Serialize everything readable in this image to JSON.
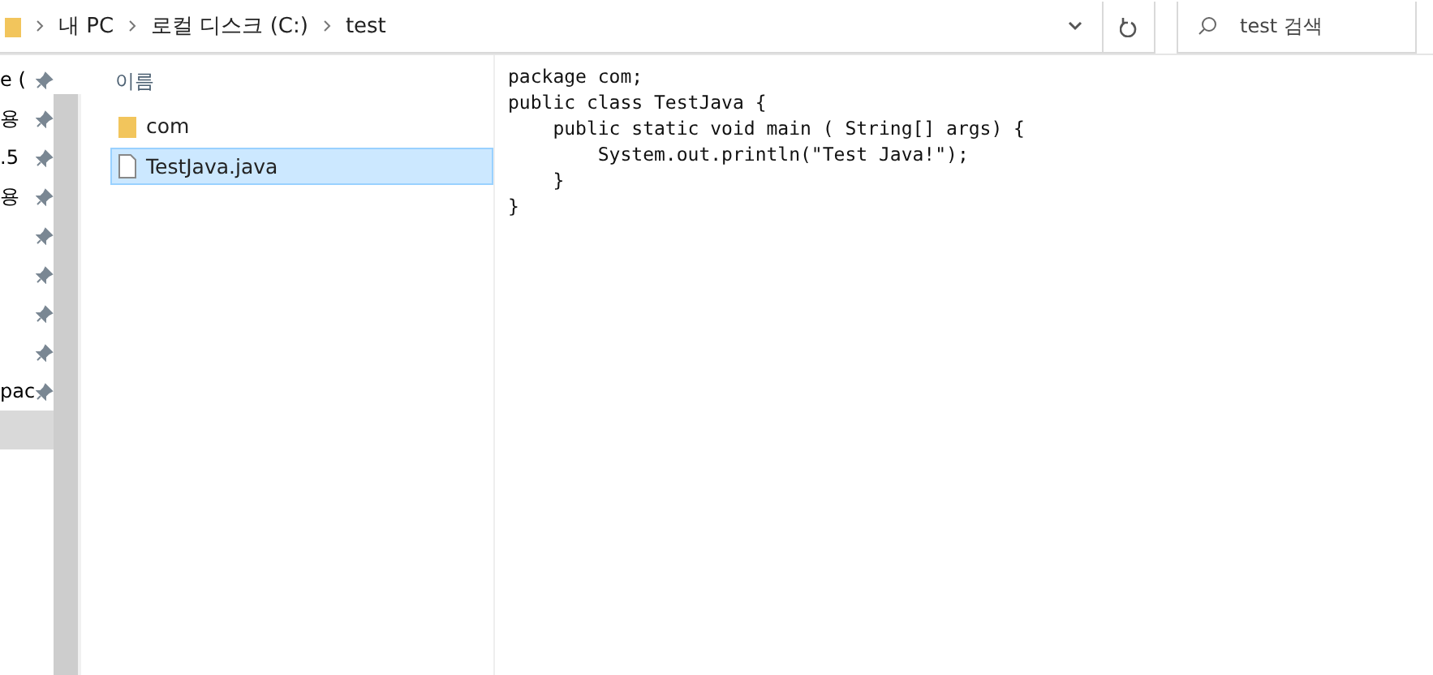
{
  "breadcrumb": [
    "내 PC",
    "로컬 디스크 (C:)",
    "test"
  ],
  "search": {
    "placeholder": "test 검색"
  },
  "sidebar": {
    "items": [
      {
        "label": "e (",
        "pinned": true,
        "selected": false
      },
      {
        "label": "용",
        "pinned": true,
        "selected": false
      },
      {
        "label": ".5",
        "pinned": true,
        "selected": false
      },
      {
        "label": "용",
        "pinned": true,
        "selected": false
      },
      {
        "pinned": true,
        "selected": false
      },
      {
        "pinned": true,
        "selected": false
      },
      {
        "pinned": true,
        "selected": false
      },
      {
        "pinned": true,
        "selected": false
      },
      {
        "label": "pac",
        "pinned": true,
        "selected": false
      },
      {
        "pinned": false,
        "selected": true
      }
    ]
  },
  "files": {
    "column": "이름",
    "items": [
      {
        "name": "com",
        "kind": "folder",
        "selected": false
      },
      {
        "name": "TestJava.java",
        "kind": "file",
        "selected": true
      }
    ]
  },
  "preview": {
    "lines": [
      "package com;",
      "public class TestJava {",
      "    public static void main ( String[] args) {",
      "        System.out.println(\"Test Java!\");",
      "    }",
      "}"
    ]
  }
}
